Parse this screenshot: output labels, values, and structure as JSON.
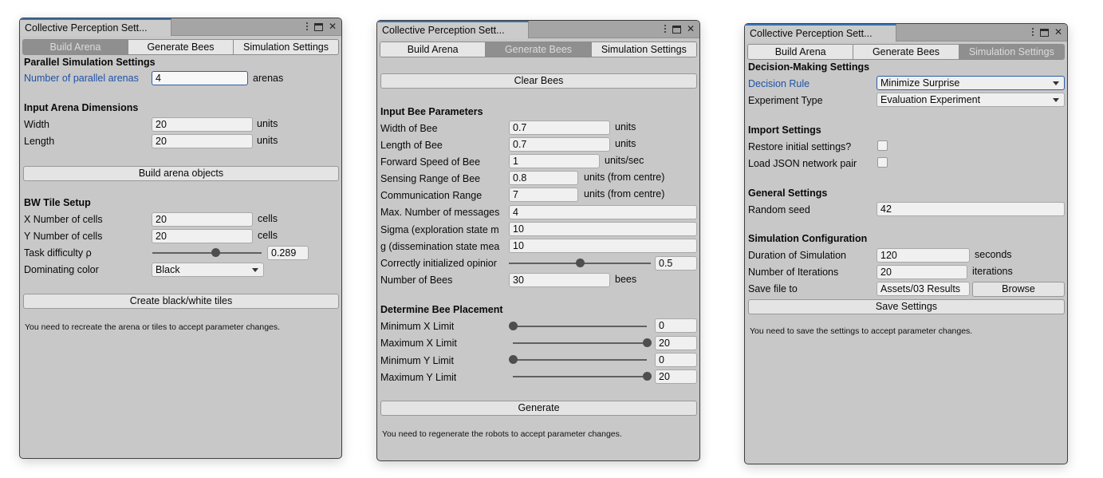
{
  "windows": [
    {
      "title": "Collective Perception Sett...",
      "tabs": [
        "Build Arena",
        "Generate Bees",
        "Simulation Settings"
      ],
      "active_tab": "Build Arena",
      "parallel": {
        "header": "Parallel Simulation Settings",
        "label": "Number of parallel arenas",
        "value": "4",
        "unit": "arenas"
      },
      "dimensions": {
        "header": "Input Arena Dimensions",
        "width_label": "Width",
        "width_value": "20",
        "width_unit": "units",
        "length_label": "Length",
        "length_value": "20",
        "length_unit": "units"
      },
      "build_button": "Build arena objects",
      "tile": {
        "header": "BW Tile Setup",
        "x_label": "X Number of cells",
        "x_value": "20",
        "x_unit": "cells",
        "y_label": "Y Number of cells",
        "y_value": "20",
        "y_unit": "cells",
        "difficulty_label": "Task difficulty ρ",
        "difficulty_value": "0.289",
        "difficulty_level": 0.578,
        "color_label": "Dominating color",
        "color_value": "Black"
      },
      "create_button": "Create black/white tiles",
      "note": "You need to recreate the arena or tiles to accept parameter changes."
    },
    {
      "title": "Collective Perception Sett...",
      "tabs": [
        "Build Arena",
        "Generate Bees",
        "Simulation Settings"
      ],
      "active_tab": "Generate Bees",
      "clear_button": "Clear Bees",
      "params": {
        "header": "Input Bee Parameters",
        "width_label": "Width of Bee",
        "width_value": "0.7",
        "width_unit": "units",
        "length_label": "Length of Bee",
        "length_value": "0.7",
        "length_unit": "units",
        "speed_label": "Forward Speed of Bee",
        "speed_value": "1",
        "speed_unit": "units/sec",
        "sensing_label": "Sensing Range of Bee",
        "sensing_value": "0.8",
        "sensing_unit": "units (from centre)",
        "comm_label": "Communication Range",
        "comm_value": "7",
        "comm_unit": "units (from centre)",
        "maxmsg_label": "Max. Number of messages",
        "maxmsg_value": "4",
        "sigma_label": "Sigma (exploration state m",
        "sigma_value": "10",
        "g_label": "g (dissemination state mea",
        "g_value": "10",
        "opinion_label": "Correctly initialized opinior",
        "opinion_value": "0.5",
        "opinion_level": 0.5,
        "num_label": "Number of Bees",
        "num_value": "30",
        "num_unit": "bees"
      },
      "placement": {
        "header": "Determine Bee Placement",
        "minx_label": "Minimum X Limit",
        "minx_value": "0",
        "minx_level": 0.0,
        "maxx_label": "Maximum X Limit",
        "maxx_value": "20",
        "maxx_level": 1.0,
        "miny_label": "Minimum Y Limit",
        "miny_value": "0",
        "miny_level": 0.0,
        "maxy_label": "Maximum Y Limit",
        "maxy_value": "20",
        "maxy_level": 1.0
      },
      "generate_button": "Generate",
      "note": "You need to regenerate the robots to accept parameter changes."
    },
    {
      "title": "Collective Perception Sett...",
      "tabs": [
        "Build Arena",
        "Generate Bees",
        "Simulation Settings"
      ],
      "active_tab": "Simulation Settings",
      "decision": {
        "header": "Decision-Making Settings",
        "rule_label": "Decision Rule",
        "rule_value": "Minimize Surprise",
        "type_label": "Experiment Type",
        "type_value": "Evaluation Experiment"
      },
      "import": {
        "header": "Import Settings",
        "restore_label": "Restore initial settings?",
        "restore_checked": false,
        "json_label": "Load JSON network pair",
        "json_checked": false
      },
      "general": {
        "header": "General Settings",
        "seed_label": "Random seed",
        "seed_value": "42"
      },
      "simulation": {
        "header": "Simulation Configuration",
        "duration_label": "Duration of Simulation",
        "duration_value": "120",
        "duration_unit": "seconds",
        "iter_label": "Number of Iterations",
        "iter_value": "20",
        "iter_unit": "iterations",
        "save_label": "Save file to",
        "save_value": "Assets/03 Results",
        "browse_button": "Browse"
      },
      "save_button": "Save Settings",
      "note": "You need to save the settings to accept parameter changes."
    }
  ]
}
